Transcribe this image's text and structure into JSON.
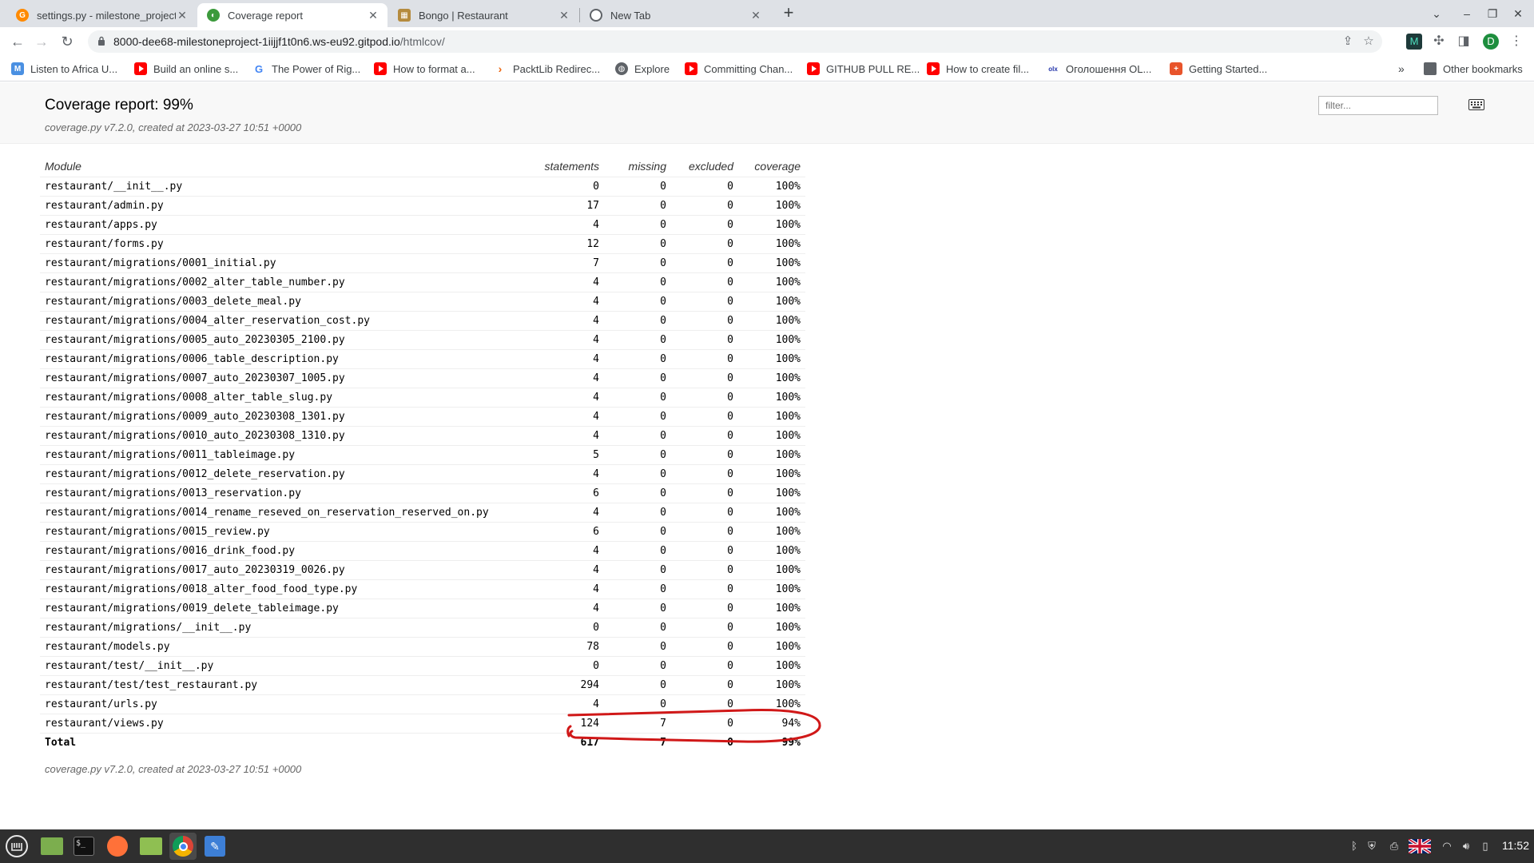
{
  "browser": {
    "tabs": [
      {
        "title": "settings.py - milestone_project",
        "icon": "gitpod-icon",
        "active": false
      },
      {
        "title": "Coverage report",
        "icon": "coverage-icon",
        "active": true
      },
      {
        "title": "Bongo | Restaurant",
        "icon": "restaurant-icon",
        "active": false
      },
      {
        "title": "New Tab",
        "icon": "chrome-icon",
        "active": false
      }
    ],
    "url_host": "8000-dee68-milestoneproject-1iijjf1t0n6.ws-eu92.gitpod.io",
    "url_path": "/htmlcov/",
    "profile_initial": "D",
    "bookmarks": [
      {
        "label": "Listen to Africa U...",
        "icon": "m-icon"
      },
      {
        "label": "Build an online s...",
        "icon": "youtube-icon"
      },
      {
        "label": "The Power of Rig...",
        "icon": "google-icon"
      },
      {
        "label": "How to format a...",
        "icon": "youtube-icon"
      },
      {
        "label": "PacktLib Redirec...",
        "icon": "packt-icon"
      },
      {
        "label": "Explore",
        "icon": "globe-icon"
      },
      {
        "label": "Committing Chan...",
        "icon": "youtube-icon"
      },
      {
        "label": "GITHUB PULL RE...",
        "icon": "youtube-icon"
      },
      {
        "label": "How to create fil...",
        "icon": "youtube-icon"
      },
      {
        "label": "Оголошення OL...",
        "icon": "olx-icon"
      },
      {
        "label": "Getting Started...",
        "icon": "plus-icon"
      }
    ],
    "other_bookmarks": "Other bookmarks"
  },
  "report": {
    "title": "Coverage report: 99%",
    "meta": "coverage.py v7.2.0, created at 2023-03-27 10:51 +0000",
    "filter_placeholder": "filter...",
    "columns": {
      "module": "Module",
      "statements": "statements",
      "missing": "missing",
      "excluded": "excluded",
      "coverage": "coverage"
    },
    "rows": [
      {
        "module": "restaurant/__init__.py",
        "statements": "0",
        "missing": "0",
        "excluded": "0",
        "coverage": "100%"
      },
      {
        "module": "restaurant/admin.py",
        "statements": "17",
        "missing": "0",
        "excluded": "0",
        "coverage": "100%"
      },
      {
        "module": "restaurant/apps.py",
        "statements": "4",
        "missing": "0",
        "excluded": "0",
        "coverage": "100%"
      },
      {
        "module": "restaurant/forms.py",
        "statements": "12",
        "missing": "0",
        "excluded": "0",
        "coverage": "100%"
      },
      {
        "module": "restaurant/migrations/0001_initial.py",
        "statements": "7",
        "missing": "0",
        "excluded": "0",
        "coverage": "100%"
      },
      {
        "module": "restaurant/migrations/0002_alter_table_number.py",
        "statements": "4",
        "missing": "0",
        "excluded": "0",
        "coverage": "100%"
      },
      {
        "module": "restaurant/migrations/0003_delete_meal.py",
        "statements": "4",
        "missing": "0",
        "excluded": "0",
        "coverage": "100%"
      },
      {
        "module": "restaurant/migrations/0004_alter_reservation_cost.py",
        "statements": "4",
        "missing": "0",
        "excluded": "0",
        "coverage": "100%"
      },
      {
        "module": "restaurant/migrations/0005_auto_20230305_2100.py",
        "statements": "4",
        "missing": "0",
        "excluded": "0",
        "coverage": "100%"
      },
      {
        "module": "restaurant/migrations/0006_table_description.py",
        "statements": "4",
        "missing": "0",
        "excluded": "0",
        "coverage": "100%"
      },
      {
        "module": "restaurant/migrations/0007_auto_20230307_1005.py",
        "statements": "4",
        "missing": "0",
        "excluded": "0",
        "coverage": "100%"
      },
      {
        "module": "restaurant/migrations/0008_alter_table_slug.py",
        "statements": "4",
        "missing": "0",
        "excluded": "0",
        "coverage": "100%"
      },
      {
        "module": "restaurant/migrations/0009_auto_20230308_1301.py",
        "statements": "4",
        "missing": "0",
        "excluded": "0",
        "coverage": "100%"
      },
      {
        "module": "restaurant/migrations/0010_auto_20230308_1310.py",
        "statements": "4",
        "missing": "0",
        "excluded": "0",
        "coverage": "100%"
      },
      {
        "module": "restaurant/migrations/0011_tableimage.py",
        "statements": "5",
        "missing": "0",
        "excluded": "0",
        "coverage": "100%"
      },
      {
        "module": "restaurant/migrations/0012_delete_reservation.py",
        "statements": "4",
        "missing": "0",
        "excluded": "0",
        "coverage": "100%"
      },
      {
        "module": "restaurant/migrations/0013_reservation.py",
        "statements": "6",
        "missing": "0",
        "excluded": "0",
        "coverage": "100%"
      },
      {
        "module": "restaurant/migrations/0014_rename_reseved_on_reservation_reserved_on.py",
        "statements": "4",
        "missing": "0",
        "excluded": "0",
        "coverage": "100%"
      },
      {
        "module": "restaurant/migrations/0015_review.py",
        "statements": "6",
        "missing": "0",
        "excluded": "0",
        "coverage": "100%"
      },
      {
        "module": "restaurant/migrations/0016_drink_food.py",
        "statements": "4",
        "missing": "0",
        "excluded": "0",
        "coverage": "100%"
      },
      {
        "module": "restaurant/migrations/0017_auto_20230319_0026.py",
        "statements": "4",
        "missing": "0",
        "excluded": "0",
        "coverage": "100%"
      },
      {
        "module": "restaurant/migrations/0018_alter_food_food_type.py",
        "statements": "4",
        "missing": "0",
        "excluded": "0",
        "coverage": "100%"
      },
      {
        "module": "restaurant/migrations/0019_delete_tableimage.py",
        "statements": "4",
        "missing": "0",
        "excluded": "0",
        "coverage": "100%"
      },
      {
        "module": "restaurant/migrations/__init__.py",
        "statements": "0",
        "missing": "0",
        "excluded": "0",
        "coverage": "100%"
      },
      {
        "module": "restaurant/models.py",
        "statements": "78",
        "missing": "0",
        "excluded": "0",
        "coverage": "100%"
      },
      {
        "module": "restaurant/test/__init__.py",
        "statements": "0",
        "missing": "0",
        "excluded": "0",
        "coverage": "100%"
      },
      {
        "module": "restaurant/test/test_restaurant.py",
        "statements": "294",
        "missing": "0",
        "excluded": "0",
        "coverage": "100%"
      },
      {
        "module": "restaurant/urls.py",
        "statements": "4",
        "missing": "0",
        "excluded": "0",
        "coverage": "100%"
      },
      {
        "module": "restaurant/views.py",
        "statements": "124",
        "missing": "7",
        "excluded": "0",
        "coverage": "94%"
      }
    ],
    "total": {
      "module": "Total",
      "statements": "617",
      "missing": "7",
      "excluded": "0",
      "coverage": "99%"
    },
    "footer_meta": "coverage.py v7.2.0, created at 2023-03-27 10:51 +0000",
    "annotation_color": "#d01818"
  },
  "taskbar": {
    "clock": "11:52"
  }
}
